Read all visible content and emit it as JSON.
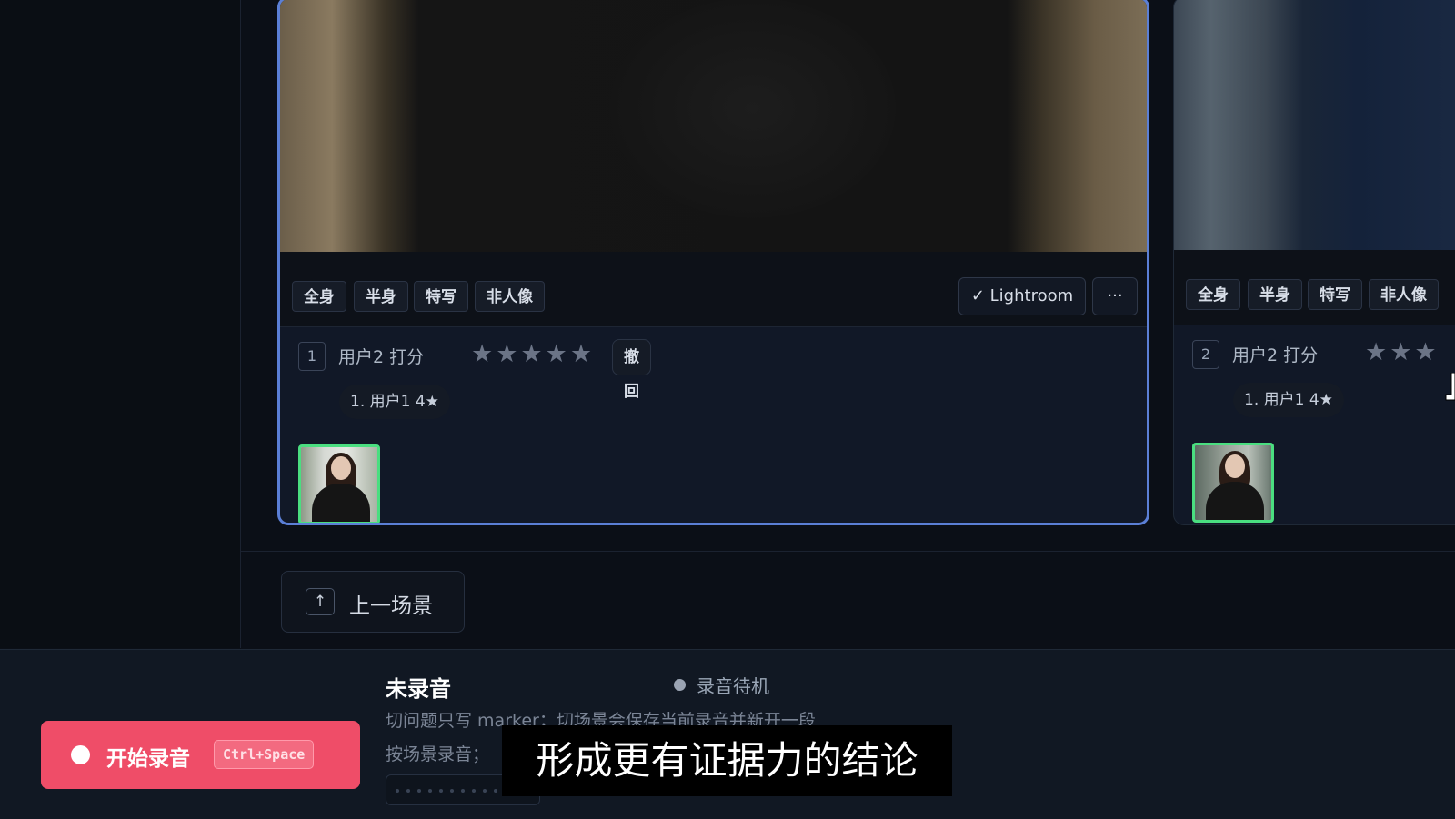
{
  "cards": [
    {
      "index": "1",
      "tags": [
        "全身",
        "半身",
        "特写",
        "非人像"
      ],
      "lightroom_label": "✓ Lightroom",
      "more_label": "···",
      "rating_label": "用户2 打分",
      "stars": "★★★★★",
      "undo_label": "撤回",
      "vote": "1. 用户1 4★"
    },
    {
      "index": "2",
      "tags": [
        "全身",
        "半身",
        "特写",
        "非人像"
      ],
      "rating_label": "用户2 打分",
      "stars": "★★★",
      "vote": "1. 用户1 4★"
    }
  ],
  "nav": {
    "prev_scene_icon": "↑",
    "prev_scene_label": "上一场景"
  },
  "recorder": {
    "button_label": "开始录音",
    "shortcut": "Ctrl+Space",
    "status_title": "未录音",
    "status_badge": "录音待机",
    "hint_line1": "切问题只写 marker；切场景会保存当前录音并新开一段",
    "hint_line2": "按场景录音；"
  },
  "subtitle": "形成更有证据力的结论",
  "colors": {
    "accent_selected": "#5b7fd6",
    "record_button": "#ef4d68",
    "thumb_border": "#4ade80"
  }
}
